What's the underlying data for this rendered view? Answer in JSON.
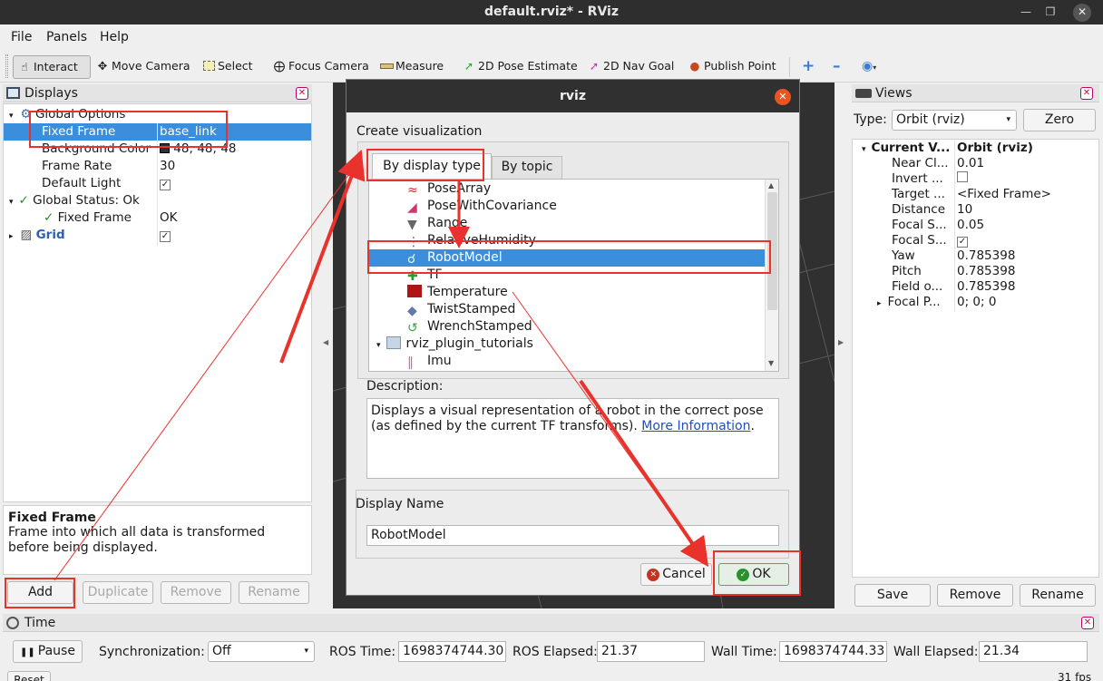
{
  "window": {
    "title": "default.rviz* - RViz"
  },
  "menu": {
    "file": "File",
    "panels": "Panels",
    "help": "Help"
  },
  "toolbar": {
    "interact": "Interact",
    "move_camera": "Move Camera",
    "select": "Select",
    "focus_camera": "Focus Camera",
    "measure": "Measure",
    "pose_estimate": "2D Pose Estimate",
    "nav_goal": "2D Nav Goal",
    "publish_point": "Publish Point"
  },
  "displays": {
    "title": "Displays",
    "rows": {
      "global_options": "Global Options",
      "fixed_frame": "Fixed Frame",
      "fixed_frame_value": "base_link",
      "background_color": "Background Color",
      "background_color_value": "48; 48; 48",
      "frame_rate": "Frame Rate",
      "frame_rate_value": "30",
      "default_light": "Default Light",
      "global_status": "Global Status: Ok",
      "status_fixed_frame": "Fixed Frame",
      "status_fixed_frame_value": "OK",
      "grid": "Grid"
    },
    "help_title": "Fixed Frame",
    "help_text": "Frame into which all data is transformed before being displayed.",
    "buttons": {
      "add": "Add",
      "duplicate": "Duplicate",
      "remove": "Remove",
      "rename": "Rename"
    }
  },
  "dialog": {
    "title": "rviz",
    "heading": "Create visualization",
    "tabs": {
      "by_display_type": "By display type",
      "by_topic": "By topic"
    },
    "items": {
      "pose_array": "PoseArray",
      "pose_cov": "PoseWithCovariance",
      "range": "Range",
      "humidity": "RelativeHumidity",
      "robot_model": "RobotModel",
      "tf": "TF",
      "temperature": "Temperature",
      "twist": "TwistStamped",
      "wrench": "WrenchStamped",
      "plugin_folder": "rviz_plugin_tutorials",
      "imu": "Imu"
    },
    "description_label": "Description:",
    "description_text": "Displays a visual representation of a robot in the correct pose (as defined by the current TF transforms). ",
    "more_info": "More Information",
    "description_end": ".",
    "display_name_label": "Display Name",
    "display_name_value": "RobotModel",
    "cancel": "Cancel",
    "ok": "OK"
  },
  "views": {
    "title": "Views",
    "type_label": "Type:",
    "type_value": "Orbit (rviz)",
    "zero": "Zero",
    "rows": {
      "current_view": "Current V...",
      "current_view_value": "Orbit (rviz)",
      "near_clip": "Near Cl...",
      "near_clip_value": "0.01",
      "invert": "Invert ...",
      "target": "Target ...",
      "target_value": "<Fixed Frame>",
      "distance": "Distance",
      "distance_value": "10",
      "focal_size": "Focal S...",
      "focal_size_value": "0.05",
      "focal_shape": "Focal S...",
      "yaw": "Yaw",
      "yaw_value": "0.785398",
      "pitch": "Pitch",
      "pitch_value": "0.785398",
      "field_of_view": "Field o...",
      "field_of_view_value": "0.785398",
      "focal_point": "Focal P...",
      "focal_point_value": "0; 0; 0"
    },
    "buttons": {
      "save": "Save",
      "remove": "Remove",
      "rename": "Rename"
    }
  },
  "time": {
    "title": "Time",
    "pause": "Pause",
    "sync_label": "Synchronization:",
    "sync_value": "Off",
    "ros_time_label": "ROS Time:",
    "ros_time_value": "1698374744.30",
    "ros_elapsed_label": "ROS Elapsed:",
    "ros_elapsed_value": "21.37",
    "wall_time_label": "Wall Time:",
    "wall_time_value": "1698374744.33",
    "wall_elapsed_label": "Wall Elapsed:",
    "wall_elapsed_value": "21.34",
    "reset": "Reset",
    "fps": "31 fps"
  },
  "colors": {
    "accent": "#3584e4",
    "selection": "#3b8edb",
    "annotation": "#e8322b",
    "viewport": "#303030"
  }
}
